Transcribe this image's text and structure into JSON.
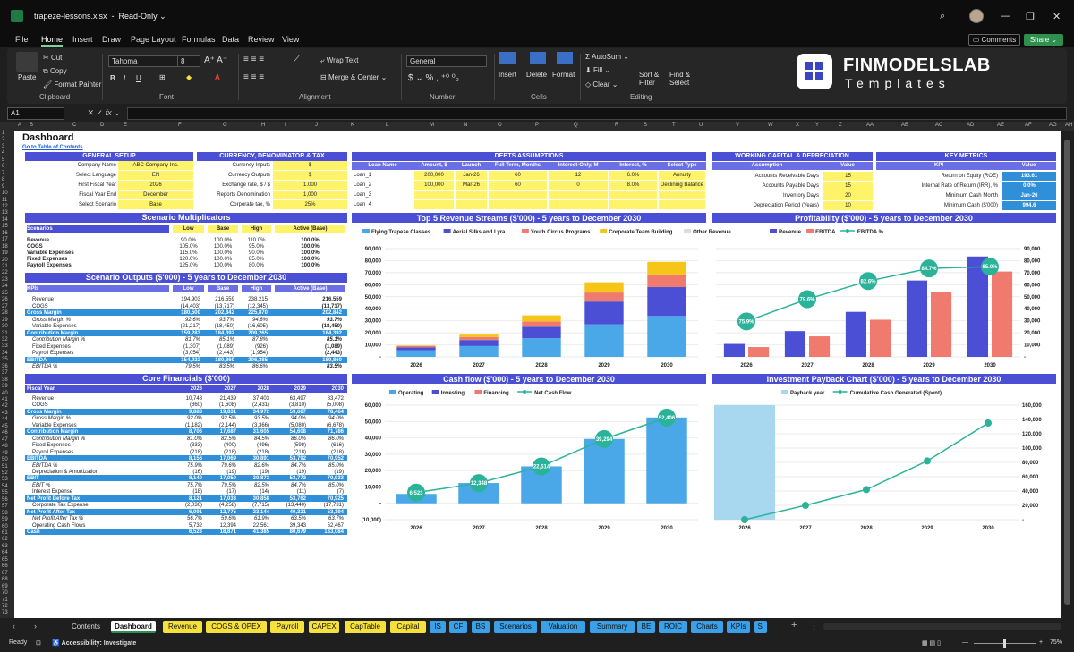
{
  "window": {
    "file": "trapeze-lessons.xlsx",
    "mode": "Read-Only",
    "comments": "Comments",
    "share": "Share"
  },
  "menu": [
    "File",
    "Home",
    "Insert",
    "Draw",
    "Page Layout",
    "Formulas",
    "Data",
    "Review",
    "View"
  ],
  "ribbon": {
    "paste": "Paste",
    "cut": "Cut",
    "copy": "Copy",
    "format_painter": "Format Painter",
    "clipboard": "Clipboard",
    "font_name": "Tahoma",
    "font_size": "8",
    "font": "Font",
    "wrap_text": "Wrap Text",
    "merge_center": "Merge & Center",
    "alignment": "Alignment",
    "number_format": "General",
    "number": "Number",
    "insert": "Insert",
    "delete": "Delete",
    "format": "Format",
    "cells": "Cells",
    "autosum": "AutoSum",
    "fill": "Fill",
    "clear": "Clear",
    "sort_filter": "Sort & Filter",
    "find_select": "Find & Select",
    "editing": "Editing"
  },
  "brand": {
    "line1": "FINMODELSLAB",
    "line2": "Templates",
    "color": "#3a45c4"
  },
  "name_box": "A1",
  "columns": [
    "A",
    "B",
    "C",
    "D",
    "E",
    "F",
    "G",
    "H",
    "I",
    "J",
    "K",
    "L",
    "M",
    "N",
    "O",
    "P",
    "Q",
    "R",
    "S",
    "T",
    "U",
    "V",
    "W",
    "X",
    "Y",
    "Z",
    "AA",
    "AB",
    "AC",
    "AD",
    "AE",
    "AF",
    "AG",
    "AH"
  ],
  "dashboard": {
    "title": "Dashboard",
    "toc": "Go to Table of Contents",
    "general": {
      "header": "GENERAL SETUP",
      "rows": [
        [
          "Company Name",
          "ABC Company Inc."
        ],
        [
          "Select Language",
          "EN"
        ],
        [
          "First Fiscal Year",
          "2026"
        ],
        [
          "Fiscal Year End",
          "December"
        ],
        [
          "Select Scenario",
          "Base"
        ]
      ]
    },
    "currency": {
      "header": "CURRENCY, DENOMINATOR & TAX",
      "rows": [
        [
          "Currency Inputs",
          "$"
        ],
        [
          "Currency Outputs",
          "$"
        ],
        [
          "Exchange rate, $ / $",
          "1.000"
        ],
        [
          "Reports Denomination",
          "1,000"
        ],
        [
          "Corporate tax, %",
          "25%"
        ]
      ]
    },
    "debts": {
      "header": "DEBTS ASSUMPTIONS",
      "cols": [
        "Loan Name",
        "Amount, $",
        "Launch",
        "Full Term, Months",
        "Interest-Only, M",
        "Interest, %",
        "Select Type"
      ],
      "rows": [
        [
          "Loan_1",
          "200,000",
          "Jan-26",
          "60",
          "12",
          "6.0%",
          "Annuity"
        ],
        [
          "Loan_2",
          "100,000",
          "Mar-26",
          "60",
          "0",
          "8.0%",
          "Declining Balance"
        ],
        [
          "Loan_3",
          "",
          "",
          "",
          "",
          "",
          ""
        ],
        [
          "Loan_4",
          "",
          "",
          "",
          "",
          "",
          ""
        ]
      ]
    },
    "wc": {
      "header": "WORKING CAPITAL & DEPRECIATION",
      "cols": [
        "Assumption",
        "Value"
      ],
      "rows": [
        [
          "Accounts Receivable Days",
          "15"
        ],
        [
          "Accounts Payable Days",
          "15"
        ],
        [
          "Inventory Days",
          "20"
        ],
        [
          "Depreciation Period (Years)",
          "10"
        ]
      ]
    },
    "kpi": {
      "header": "KEY METRICS",
      "cols": [
        "KPI",
        "Value"
      ],
      "rows": [
        [
          "Return on Equity (ROE)",
          "193.61"
        ],
        [
          "Internal Rate of Return (IRR), %",
          "0.0%"
        ],
        [
          "Minimum Cash Month",
          "Jan-26"
        ],
        [
          "Minimum Cash ($'000)",
          "994.6"
        ]
      ]
    },
    "multipliers": {
      "title": "Scenario Multiplicators",
      "cols": [
        "Scenarios",
        "Low",
        "Base",
        "High",
        "Active (Base)"
      ],
      "rows": [
        [
          "Revenue",
          "90.0%",
          "100.0%",
          "110.0%",
          "100.0%"
        ],
        [
          "COGS",
          "105.0%",
          "100.0%",
          "95.0%",
          "100.0%"
        ],
        [
          "Variable Expenses",
          "115.0%",
          "100.0%",
          "90.0%",
          "100.0%"
        ],
        [
          "Fixed Expenses",
          "120.0%",
          "100.0%",
          "85.0%",
          "100.0%"
        ],
        [
          "Payroll Expenses",
          "125.0%",
          "100.0%",
          "80.0%",
          "100.0%"
        ]
      ]
    },
    "outputs": {
      "title": "Scenario Outputs ($'000) - 5 years to December 2030",
      "cols": [
        "KPIs",
        "Low",
        "Base",
        "High",
        "Active (Base)"
      ],
      "rows": [
        {
          "label": "Revenue",
          "v": [
            "194,903",
            "216,559",
            "238,215",
            "216,559"
          ],
          "style": "n"
        },
        {
          "label": "COGS",
          "v": [
            "(14,403)",
            "(13,717)",
            "(12,345)",
            "(13,717)"
          ],
          "style": "n"
        },
        {
          "label": "Gross Margin",
          "v": [
            "180,500",
            "202,842",
            "225,870",
            "202,842"
          ],
          "style": "b"
        },
        {
          "label": "Gross Margin %",
          "v": [
            "92.6%",
            "93.7%",
            "94.8%",
            "93.7%"
          ],
          "style": "i"
        },
        {
          "label": "Variable Expenses",
          "v": [
            "(21,217)",
            "(18,450)",
            "(16,605)",
            "(18,450)"
          ],
          "style": "n"
        },
        {
          "label": "Contribution Margin",
          "v": [
            "159,283",
            "184,392",
            "209,265",
            "184,392"
          ],
          "style": "b"
        },
        {
          "label": "Contribution Margin %",
          "v": [
            "81.7%",
            "85.1%",
            "87.8%",
            "85.1%"
          ],
          "style": "i"
        },
        {
          "label": "Fixed Expenses",
          "v": [
            "(1,307)",
            "(1,089)",
            "(926)",
            "(1,089)"
          ],
          "style": "n"
        },
        {
          "label": "Payroll Expenses",
          "v": [
            "(3,054)",
            "(2,443)",
            "(1,954)",
            "(2,443)"
          ],
          "style": "n"
        },
        {
          "label": "EBITDA",
          "v": [
            "154,922",
            "180,860",
            "206,385",
            "180,860"
          ],
          "style": "b"
        },
        {
          "label": "EBITDA %",
          "v": [
            "79.5%",
            "83.5%",
            "86.6%",
            "83.5%"
          ],
          "style": "i"
        }
      ]
    },
    "core": {
      "title": "Core Financials ($'000)",
      "cols": [
        "Fiscal Year",
        "2026",
        "2027",
        "2028",
        "2029",
        "2030"
      ],
      "rows": [
        {
          "label": "Revenue",
          "v": [
            "10,748",
            "21,439",
            "37,403",
            "63,497",
            "83,472"
          ],
          "style": "n"
        },
        {
          "label": "COGS",
          "v": [
            "(860)",
            "(1,608)",
            "(2,431)",
            "(3,810)",
            "(5,008)"
          ],
          "style": "n"
        },
        {
          "label": "Gross Margin",
          "v": [
            "9,888",
            "19,831",
            "34,972",
            "59,687",
            "78,464"
          ],
          "style": "b"
        },
        {
          "label": "Gross Margin %",
          "v": [
            "92.0%",
            "92.5%",
            "93.5%",
            "94.0%",
            "94.0%"
          ],
          "style": "i"
        },
        {
          "label": "Variable Expenses",
          "v": [
            "(1,182)",
            "(2,144)",
            "(3,366)",
            "(5,080)",
            "(6,678)"
          ],
          "style": "n"
        },
        {
          "label": "Contribution Margin",
          "v": [
            "8,706",
            "17,687",
            "31,605",
            "54,608",
            "71,786"
          ],
          "style": "b"
        },
        {
          "label": "Contribution Margin %",
          "v": [
            "81.0%",
            "82.5%",
            "84.5%",
            "86.0%",
            "86.0%"
          ],
          "style": "i"
        },
        {
          "label": "Fixed Expenses",
          "v": [
            "(333)",
            "(400)",
            "(496)",
            "(598)",
            "(616)"
          ],
          "style": "n"
        },
        {
          "label": "Payroll Expenses",
          "v": [
            "(218)",
            "(218)",
            "(218)",
            "(218)",
            "(218)"
          ],
          "style": "n"
        },
        {
          "label": "EBITDA",
          "v": [
            "8,156",
            "17,069",
            "30,891",
            "53,792",
            "70,952"
          ],
          "style": "b"
        },
        {
          "label": "EBITDA %",
          "v": [
            "75.9%",
            "79.6%",
            "82.6%",
            "84.7%",
            "85.0%"
          ],
          "style": "i"
        },
        {
          "label": "Depreciation & Amortization",
          "v": [
            "(16)",
            "(19)",
            "(19)",
            "(19)",
            "(19)"
          ],
          "style": "n"
        },
        {
          "label": "EBIT",
          "v": [
            "8,140",
            "17,050",
            "30,872",
            "53,772",
            "70,933"
          ],
          "style": "b"
        },
        {
          "label": "EBIT %",
          "v": [
            "75.7%",
            "79.5%",
            "82.5%",
            "84.7%",
            "85.0%"
          ],
          "style": "i"
        },
        {
          "label": "Interest Expense",
          "v": [
            "(18)",
            "(17)",
            "(14)",
            "(11)",
            "(7)"
          ],
          "style": "n"
        },
        {
          "label": "Net Profit Before Tax",
          "v": [
            "8,121",
            "17,033",
            "30,858",
            "53,762",
            "70,925"
          ],
          "style": "b"
        },
        {
          "label": "Corporate Tax Expense",
          "v": [
            "(2,030)",
            "(4,258)",
            "(7,715)",
            "(13,440)",
            "(17,731)"
          ],
          "style": "n"
        },
        {
          "label": "Net Profit After Tax",
          "v": [
            "6,091",
            "12,775",
            "23,144",
            "40,321",
            "53,194"
          ],
          "style": "b"
        },
        {
          "label": "Net Profit After Tax %",
          "v": [
            "56.7%",
            "59.6%",
            "61.9%",
            "63.5%",
            "63.7%"
          ],
          "style": "i"
        },
        {
          "label": "Operating Cash Flows",
          "v": [
            "5,732",
            "12,394",
            "22,561",
            "39,343",
            "52,467"
          ],
          "style": "n"
        },
        {
          "label": "Cash",
          "v": [
            "6,523",
            "18,871",
            "41,385",
            "80,679",
            "133,084"
          ],
          "style": "c"
        }
      ]
    }
  },
  "chart_data": [
    {
      "id": "revenue",
      "type": "bar",
      "title": "Top 5 Revenue Streams ($'000) - 5 years to December 2030",
      "categories": [
        "2026",
        "2027",
        "2028",
        "2029",
        "2030"
      ],
      "series": [
        {
          "name": "Flying Trapeze Classes",
          "color": "#4aa8e8",
          "values": [
            5500,
            9000,
            15500,
            27000,
            34000
          ]
        },
        {
          "name": "Aerial Silks and Lyra",
          "color": "#4a4fd6",
          "values": [
            2500,
            5000,
            9500,
            19000,
            24000
          ]
        },
        {
          "name": "Youth Circus Programs",
          "color": "#f07a6e",
          "values": [
            1000,
            2500,
            4500,
            7500,
            10500
          ]
        },
        {
          "name": "Corporate Team Building",
          "color": "#f5c518",
          "values": [
            500,
            2000,
            5000,
            8500,
            10500
          ]
        },
        {
          "name": "Other Revenue",
          "color": "#dcdcdc",
          "values": [
            0,
            0,
            0,
            0,
            0
          ]
        }
      ],
      "ylim": [
        0,
        90000
      ],
      "yticks": [
        "-",
        "10,000",
        "20,000",
        "30,000",
        "40,000",
        "50,000",
        "60,000",
        "70,000",
        "80,000",
        "90,000"
      ]
    },
    {
      "id": "profit",
      "type": "bar+line",
      "title": "Profitability ($'000) - 5 years to December 2030",
      "categories": [
        "2026",
        "2027",
        "2028",
        "2029",
        "2030"
      ],
      "series": [
        {
          "name": "Revenue",
          "color": "#4a4fd6",
          "values": [
            10748,
            21439,
            37403,
            63497,
            83472
          ]
        },
        {
          "name": "EBITDA",
          "color": "#f07a6e",
          "values": [
            8156,
            17069,
            30891,
            53792,
            70952
          ]
        },
        {
          "name": "EBITDA %",
          "color": "#2bb39a",
          "values": [
            75.9,
            79.6,
            82.6,
            84.7,
            85.0
          ]
        }
      ],
      "labels": [
        "75.9%",
        "79.6%",
        "82.6%",
        "84.7%",
        "85.0%"
      ],
      "ylim": [
        0,
        90000
      ],
      "yticks": [
        "-",
        "10,000",
        "20,000",
        "30,000",
        "40,000",
        "50,000",
        "60,000",
        "70,000",
        "80,000",
        "90,000"
      ]
    },
    {
      "id": "cashflow",
      "type": "bar+line",
      "title": "Cash flow ($'000) - 5 years to December 2030",
      "categories": [
        "2026",
        "2027",
        "2028",
        "2029",
        "2030"
      ],
      "series": [
        {
          "name": "Operating",
          "color": "#4aa8e8",
          "values": [
            5732,
            12394,
            22561,
            39343,
            52467
          ]
        },
        {
          "name": "Investing",
          "color": "#4a4fd6",
          "values": [
            0,
            0,
            0,
            0,
            0
          ]
        },
        {
          "name": "Financing",
          "color": "#f07a6e",
          "values": [
            0,
            0,
            0,
            0,
            0
          ]
        },
        {
          "name": "Net Cash Flow",
          "color": "#2bb39a",
          "values": [
            6523,
            12348,
            22514,
            39294,
            52406
          ]
        }
      ],
      "labels": [
        "6,523",
        "12,348",
        "22,514",
        "39,294",
        "52,406"
      ],
      "ylim": [
        -10000,
        60000
      ],
      "yticks": [
        "(10,000)",
        "-",
        "10,000",
        "20,000",
        "30,000",
        "40,000",
        "50,000",
        "60,000"
      ]
    },
    {
      "id": "payback",
      "type": "bar+line",
      "title": "Investment Payback Chart ($'000) - 5 years to December 2030",
      "categories": [
        "2026",
        "2027",
        "2028",
        "2029",
        "2030"
      ],
      "series": [
        {
          "name": "Payback year",
          "color": "#a8d8f0",
          "values": [
            1,
            0,
            0,
            0,
            0
          ]
        },
        {
          "name": "Cumulative Cash Generated (Spent)",
          "color": "#2bb39a",
          "values": [
            0,
            20000,
            42000,
            82000,
            135000
          ]
        }
      ],
      "ylim": [
        0,
        160000
      ],
      "yticks": [
        "-",
        "20,000",
        "40,000",
        "60,000",
        "80,000",
        "100,000",
        "120,000",
        "140,000",
        "160,000"
      ]
    }
  ],
  "sheet_tabs": [
    {
      "label": "Contents",
      "bg": "#1f1f1f",
      "fg": "#ddd"
    },
    {
      "label": "Dashboard",
      "bg": "#ffffff",
      "fg": "#111"
    },
    {
      "label": "Revenue",
      "bg": "#f5e03c",
      "fg": "#111"
    },
    {
      "label": "COGS & OPEX",
      "bg": "#f5e03c",
      "fg": "#111"
    },
    {
      "label": "Payroll",
      "bg": "#f5e03c",
      "fg": "#111"
    },
    {
      "label": "CAPEX",
      "bg": "#f5e03c",
      "fg": "#111"
    },
    {
      "label": "CapTable",
      "bg": "#f5e03c",
      "fg": "#111"
    },
    {
      "label": "Capital",
      "bg": "#f5e03c",
      "fg": "#111"
    },
    {
      "label": "IS",
      "bg": "#3aa0e8",
      "fg": "#111"
    },
    {
      "label": "CF",
      "bg": "#3aa0e8",
      "fg": "#111"
    },
    {
      "label": "BS",
      "bg": "#3aa0e8",
      "fg": "#111"
    },
    {
      "label": "Scenarios",
      "bg": "#3aa0e8",
      "fg": "#111"
    },
    {
      "label": "Valuation",
      "bg": "#3aa0e8",
      "fg": "#111"
    },
    {
      "label": "Summary",
      "bg": "#3aa0e8",
      "fg": "#111"
    },
    {
      "label": "BE",
      "bg": "#3aa0e8",
      "fg": "#111"
    },
    {
      "label": "ROIC",
      "bg": "#3aa0e8",
      "fg": "#111"
    },
    {
      "label": "Charts",
      "bg": "#3aa0e8",
      "fg": "#111"
    },
    {
      "label": "KPIs",
      "bg": "#3aa0e8",
      "fg": "#111"
    },
    {
      "label": "Si",
      "bg": "#3aa0e8",
      "fg": "#111"
    }
  ],
  "status": {
    "ready": "Ready",
    "accessibility": "Accessibility: Investigate",
    "zoom": "75%"
  }
}
